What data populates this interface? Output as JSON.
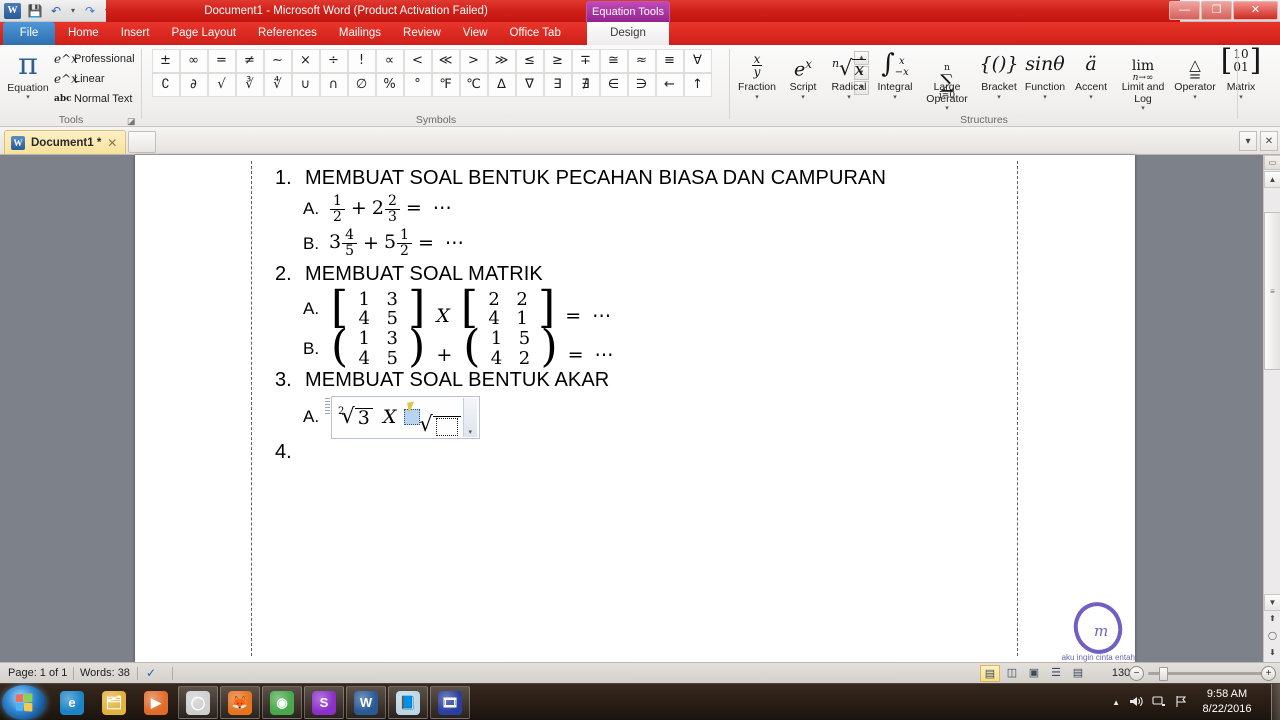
{
  "window": {
    "title": "Document1  -  Microsoft Word (Product Activation Failed)",
    "contextual_tab": "Equation Tools",
    "minimize": "—",
    "restore": "❐",
    "close": "✕"
  },
  "quick_access": {
    "app_icon": "W",
    "save": "💾",
    "undo": "↶",
    "redo": "↷",
    "customize": "▾"
  },
  "help_bar": {
    "collapse_ribbon": "⌃",
    "help": "?",
    "minimize": "—",
    "restore": "❐",
    "close": "✕"
  },
  "ribbon": {
    "file_tab": "File",
    "tabs": [
      "Home",
      "Insert",
      "Page Layout",
      "References",
      "Mailings",
      "Review",
      "View",
      "Office Tab"
    ],
    "design_tab": "Design",
    "active_tab": "Design",
    "groups": {
      "tools": {
        "label": "Tools",
        "equation_button": {
          "glyph": "π",
          "label": "Equation",
          "caret": "▾"
        },
        "items": [
          {
            "icon": "e^x",
            "label": "Professional"
          },
          {
            "icon": "e^x",
            "label": "Linear"
          },
          {
            "icon": "abc",
            "label": "Normal Text"
          }
        ],
        "dialog_launcher": "◪"
      },
      "symbols": {
        "label": "Symbols",
        "row1": [
          "±",
          "∞",
          "=",
          "≠",
          "∼",
          "×",
          "÷",
          "!",
          "∝",
          "<",
          "≪",
          ">",
          "≫",
          "≤",
          "≥",
          "∓",
          "≅",
          "≈",
          "≡",
          "∀"
        ],
        "row2": [
          "∁",
          "∂",
          "√",
          "∛",
          "∜",
          "∪",
          "∩",
          "∅",
          "%",
          "°",
          "℉",
          "℃",
          "∆",
          "∇",
          "∃",
          "∄",
          "∈",
          "∋",
          "←",
          "↑"
        ],
        "scroll_up": "▴",
        "scroll_down": "▾",
        "scroll_more": "▾"
      },
      "structures": {
        "label": "Structures",
        "items": [
          {
            "label": "Fraction",
            "glyph_type": "fraction",
            "numerator": "x",
            "denominator": "y",
            "caret": "▾"
          },
          {
            "label": "Script",
            "glyph_type": "text",
            "glyph": "e",
            "sup": "x",
            "caret": "▾"
          },
          {
            "label": "Radical",
            "glyph_type": "radical",
            "index": "n",
            "radicand": "x",
            "caret": "▾"
          },
          {
            "label": "Integral",
            "glyph_type": "integral",
            "glyph": "∫",
            "sup": "x",
            "sub": "−x",
            "caret": "▾"
          },
          {
            "label": "Large Operator",
            "glyph_type": "sigma",
            "glyph": "∑",
            "sup": "n",
            "sub": "i=0",
            "caret": "▾"
          },
          {
            "label": "Bracket",
            "glyph_type": "text",
            "glyph": "{()}",
            "caret": "▾"
          },
          {
            "label": "Function",
            "glyph_type": "text",
            "glyph": "sinθ",
            "caret": "▾"
          },
          {
            "label": "Accent",
            "glyph_type": "text",
            "glyph": "ä",
            "caret": "▾"
          },
          {
            "label": "Limit and Log",
            "glyph_type": "limit",
            "glyph": "lim",
            "sub": "n→∞",
            "caret": "▾"
          },
          {
            "label": "Operator",
            "glyph_type": "operator",
            "glyph": "≜",
            "caret": "▾"
          },
          {
            "label": "Matrix",
            "glyph_type": "matrix",
            "cells": [
              "1",
              "0",
              "0",
              "1"
            ],
            "caret": "▾"
          }
        ]
      }
    }
  },
  "document_tabs": {
    "tabs": [
      {
        "icon": "W",
        "label": "Document1 *",
        "close": "✕",
        "active": true
      }
    ],
    "new_tab": "",
    "right_buttons": [
      "▾",
      "✕"
    ]
  },
  "document": {
    "items": [
      {
        "number": "1.",
        "heading": "MEMBUAT SOAL BENTUK PECAHAN BIASA DAN CAMPURAN",
        "sub": [
          {
            "letter": "A.",
            "type": "fraction_sum",
            "terms": [
              {
                "whole": "",
                "num": "1",
                "den": "2"
              },
              {
                "whole": "2",
                "num": "2",
                "den": "3"
              }
            ],
            "operator": "+",
            "equals": "=",
            "result": "⋯"
          },
          {
            "letter": "B.",
            "type": "fraction_sum",
            "terms": [
              {
                "whole": "3",
                "num": "4",
                "den": "5"
              },
              {
                "whole": "5",
                "num": "1",
                "den": "2"
              }
            ],
            "operator": "+",
            "equals": "=",
            "result": "⋯"
          }
        ]
      },
      {
        "number": "2.",
        "heading": "MEMBUAT SOAL MATRIK",
        "sub": [
          {
            "letter": "A.",
            "type": "matrix_op",
            "bracket": "square",
            "matrix1": [
              "1",
              "3",
              "4",
              "5"
            ],
            "operator": "X",
            "matrix2": [
              "2",
              "2",
              "4",
              "1"
            ],
            "equals": "=",
            "result": "⋯"
          },
          {
            "letter": "B.",
            "type": "matrix_op",
            "bracket": "round",
            "matrix1": [
              "1",
              "3",
              "4",
              "5"
            ],
            "operator": "+",
            "matrix2": [
              "1",
              "5",
              "4",
              "2"
            ],
            "equals": "=",
            "result": "⋯"
          }
        ]
      },
      {
        "number": "3.",
        "heading": "MEMBUAT SOAL BENTUK AKAR",
        "sub": [
          {
            "letter": "A.",
            "type": "radical_op",
            "radical1": {
              "index": "2",
              "radicand": "3"
            },
            "operator": "X",
            "radical2": {
              "index": "",
              "radicand": ""
            },
            "in_equation_box": true,
            "dropdown": "▾"
          }
        ]
      },
      {
        "number": "4.",
        "heading": "",
        "sub": []
      }
    ],
    "watermark_text": "aku ingin cinta entah"
  },
  "scrollbar": {
    "split": "▭",
    "up": "▲",
    "down": "▼",
    "prev_page": "⬆",
    "select_object": "◯",
    "next_page": "⬇",
    "thumb": "≡"
  },
  "status_bar": {
    "page": "Page: 1 of 1",
    "words": "Words: 38",
    "proofing": "✓",
    "views": [
      {
        "name": "print-layout",
        "glyph": "▤",
        "active": true
      },
      {
        "name": "full-screen-reading",
        "glyph": "◫",
        "active": false
      },
      {
        "name": "web-layout",
        "glyph": "▣",
        "active": false
      },
      {
        "name": "outline",
        "glyph": "☰",
        "active": false
      },
      {
        "name": "draft",
        "glyph": "▤",
        "active": false
      }
    ],
    "zoom": "130%",
    "zoom_out": "−",
    "zoom_in": "+"
  },
  "taskbar": {
    "start": "Start",
    "pinned": [
      {
        "name": "internet-explorer",
        "glyph": "e"
      },
      {
        "name": "windows-explorer",
        "glyph": "🗂"
      },
      {
        "name": "media-player",
        "glyph": "▶"
      }
    ],
    "open": [
      {
        "name": "app-window",
        "glyph": "◯"
      },
      {
        "name": "firefox",
        "glyph": "🦊"
      },
      {
        "name": "chrome",
        "glyph": "◉"
      },
      {
        "name": "skype-like",
        "glyph": "S"
      },
      {
        "name": "microsoft-word",
        "glyph": "W"
      },
      {
        "name": "notes-app",
        "glyph": "📘"
      },
      {
        "name": "video-app",
        "glyph": "🎞"
      }
    ],
    "tray": {
      "show_hidden": "▲",
      "volume": "🔊",
      "network": "🖧",
      "action_center": "⚑"
    },
    "clock": {
      "time": "9:58 AM",
      "date": "8/22/2016"
    }
  },
  "colors": {
    "title_red": "#c2150f",
    "contextual_purple": "#a5329d",
    "file_blue": "#2f6fae",
    "workspace_gray": "#7d8189",
    "tab_yellow": "#f8e29a"
  }
}
